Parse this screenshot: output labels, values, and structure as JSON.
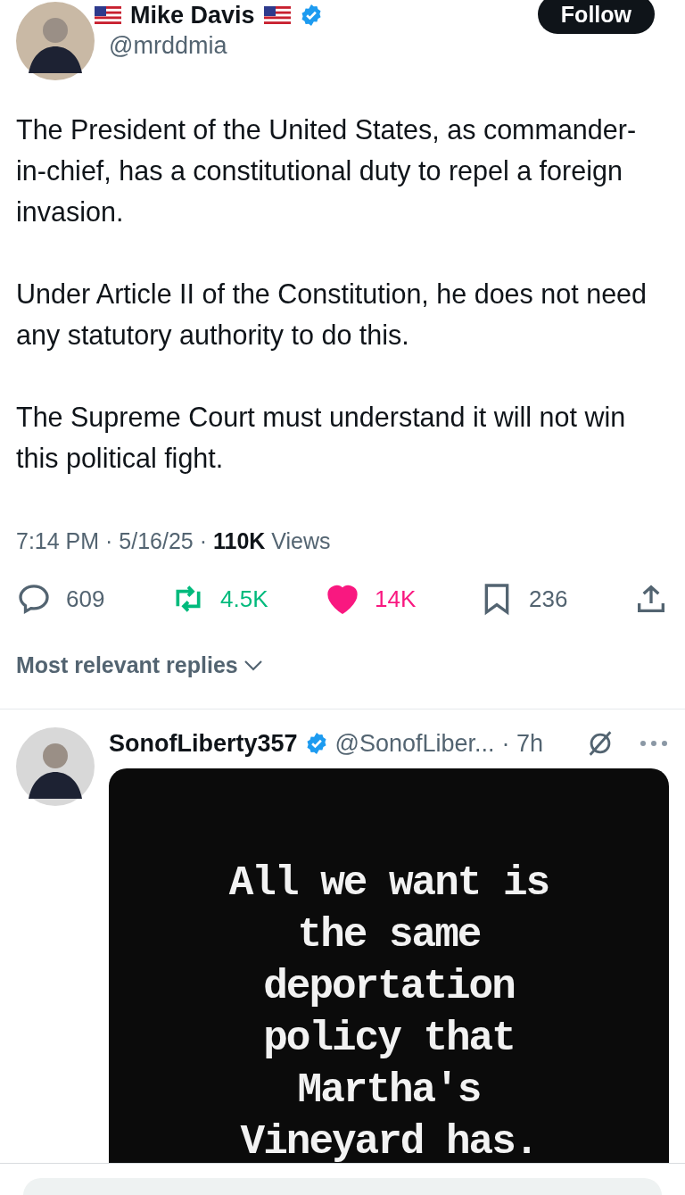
{
  "post": {
    "author": {
      "name": "Mike Davis",
      "handle": "@mrddmia",
      "verified": true
    },
    "follow_button": "Follow",
    "paragraphs": [
      "The President of the United States, as commander-in-chief, has a constitutional duty to repel a foreign invasion.",
      "Under Article II of the Constitution, he does not need any statutory authority to do this.",
      "The Supreme Court must understand it will not win this political fight."
    ],
    "meta": "7:14 PM · 5/16/25 · **110K** Views",
    "actions": [
      {
        "kind": "reply",
        "count": "609",
        "selected": false
      },
      {
        "kind": "repost",
        "count": "4.5K",
        "selected": true
      },
      {
        "kind": "like",
        "count": "14K",
        "selected": true
      },
      {
        "kind": "bookmark",
        "count": "236",
        "selected": false
      },
      {
        "kind": "share"
      }
    ]
  },
  "replies_sort": "Most relevant replies",
  "replies": [
    {
      "name": "SonofLiberty357",
      "verified": true,
      "handle": "@SonofLiber...",
      "time": "· 7h",
      "image_lines": [
        "All we want is",
        "the same",
        "deportation",
        "policy that",
        "Martha's",
        "Vineyard has."
      ]
    }
  ]
}
